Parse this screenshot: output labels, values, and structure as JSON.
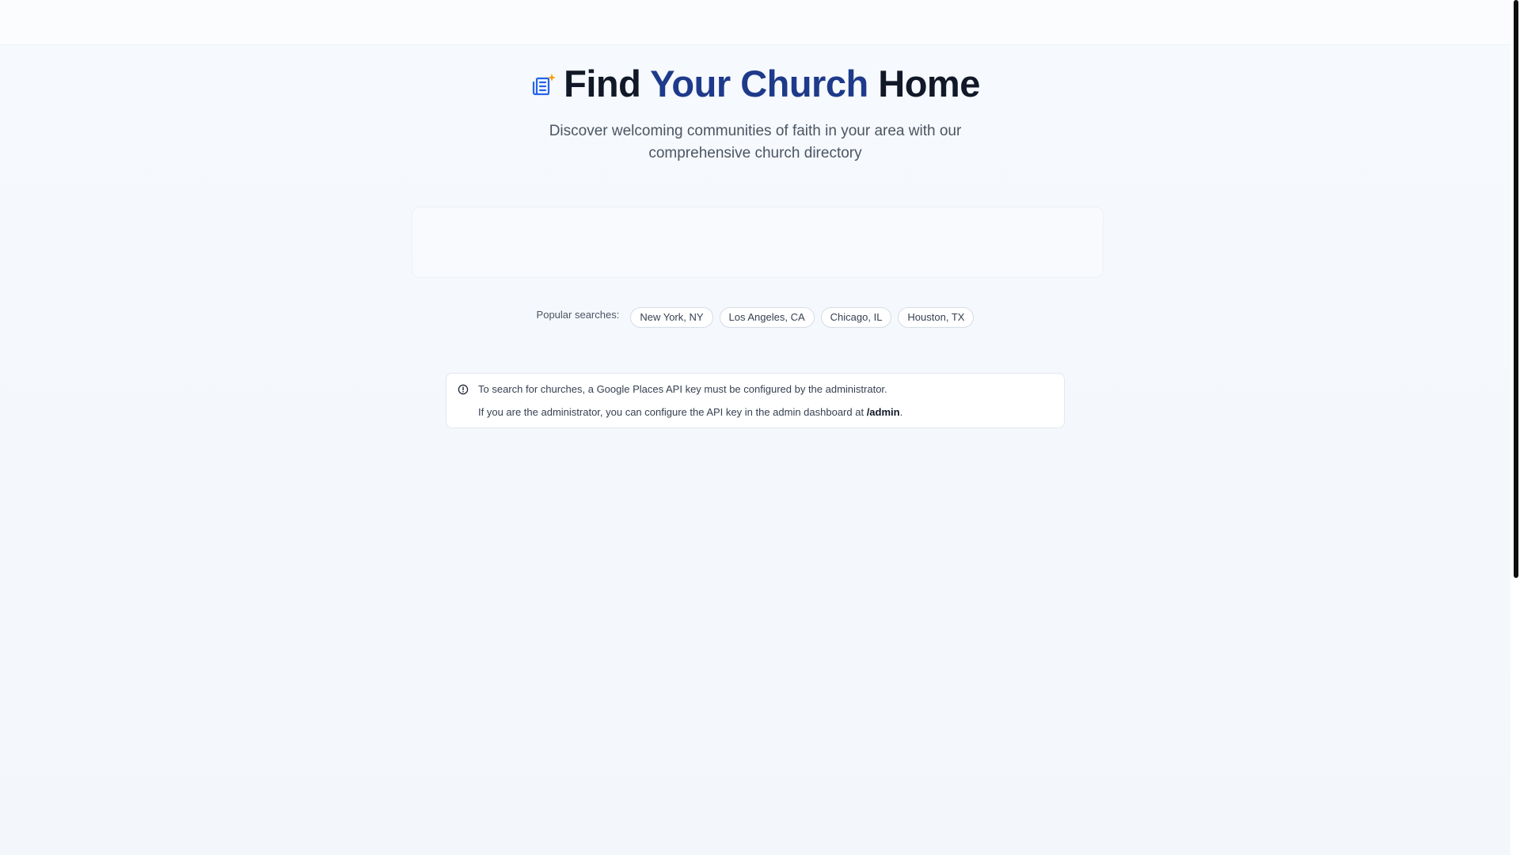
{
  "hero": {
    "title_part1": "Find ",
    "title_accent": "Your Church",
    "title_part2": " Home",
    "subtitle": "Discover welcoming communities of faith in your area with our comprehensive church directory",
    "icon": "church-directory-icon"
  },
  "popular": {
    "label": "Popular searches:",
    "items": [
      "New York, NY",
      "Los Angeles, CA",
      "Chicago, IL",
      "Houston, TX"
    ]
  },
  "alert": {
    "icon": "info-circle-icon",
    "line1": "To search for churches, a Google Places API key must be configured by the administrator.",
    "line2_prefix": "If you are the administrator, you can configure the API key in the admin dashboard at ",
    "line2_link": "/admin",
    "line2_suffix": "."
  },
  "colors": {
    "accent": "#1e3a8a",
    "icon_blue": "#2563eb",
    "icon_gold": "#f59e0b",
    "background": "#f5f8fc"
  }
}
